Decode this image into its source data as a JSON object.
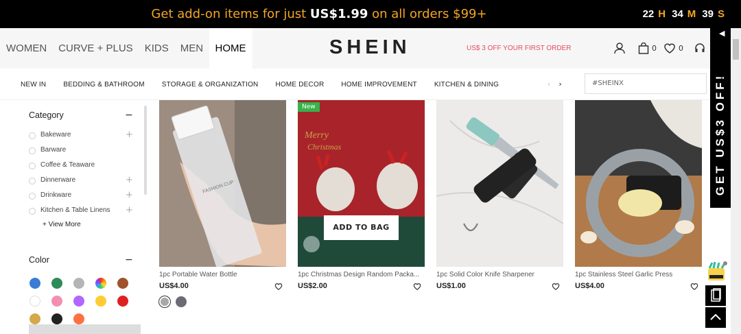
{
  "promo": {
    "text_before": "Get add-on items for just ",
    "price": "US$1.99",
    "text_after": " on all orders $99+"
  },
  "countdown": {
    "hours": "22",
    "h_unit": "H",
    "minutes": "34",
    "m_unit": "M",
    "seconds": "39",
    "s_unit": "S"
  },
  "header": {
    "nav": [
      "WOMEN",
      "CURVE + PLUS",
      "KIDS",
      "MEN",
      "HOME"
    ],
    "active_nav": "HOME",
    "logo": "SHEIN",
    "offer": "US$ 3 OFF YOUR FIRST ORDER",
    "cart_count": "0",
    "wishlist_count": "0"
  },
  "subnav": {
    "items": [
      "NEW IN",
      "BEDDING & BATHROOM",
      "STORAGE & ORGANIZATION",
      "HOME DECOR",
      "HOME IMPROVEMENT",
      "KITCHEN & DINING"
    ],
    "search_placeholder": "#SHEINX"
  },
  "side_promo": {
    "text": "GET US$3 OFF!"
  },
  "sidebar": {
    "category_title": "Category",
    "categories": [
      {
        "label": "Bakeware",
        "expandable": true
      },
      {
        "label": "Barware",
        "expandable": false
      },
      {
        "label": "Coffee & Teaware",
        "expandable": false
      },
      {
        "label": "Dinnerware",
        "expandable": true
      },
      {
        "label": "Drinkware",
        "expandable": true
      },
      {
        "label": "Kitchen & Table Linens",
        "expandable": true
      }
    ],
    "view_more": "View More",
    "color_title": "Color",
    "colors": [
      "#3a7bd5",
      "#2e8b57",
      "#b5b5b5",
      "multicolor",
      "#a0522d",
      "#ffffff",
      "#f48fb1",
      "#b266ff",
      "#ffcc33",
      "#e02020",
      "#d4a84b",
      "#222222",
      "#ff7043"
    ]
  },
  "products": [
    {
      "name": "1pc Portable Water Bottle",
      "price": "US$4.00",
      "badge": "",
      "swatches": [
        "#a8a8a8",
        "#6b6b75"
      ]
    },
    {
      "name": "1pc Christmas Design Random Packa...",
      "price": "US$2.00",
      "badge": "New",
      "hover_button": "ADD TO BAG"
    },
    {
      "name": "1pc Solid Color Knife Sharpener",
      "price": "US$1.00",
      "badge": ""
    },
    {
      "name": "1pc Stainless Steel Garlic Press",
      "price": "US$4.00",
      "badge": ""
    }
  ]
}
